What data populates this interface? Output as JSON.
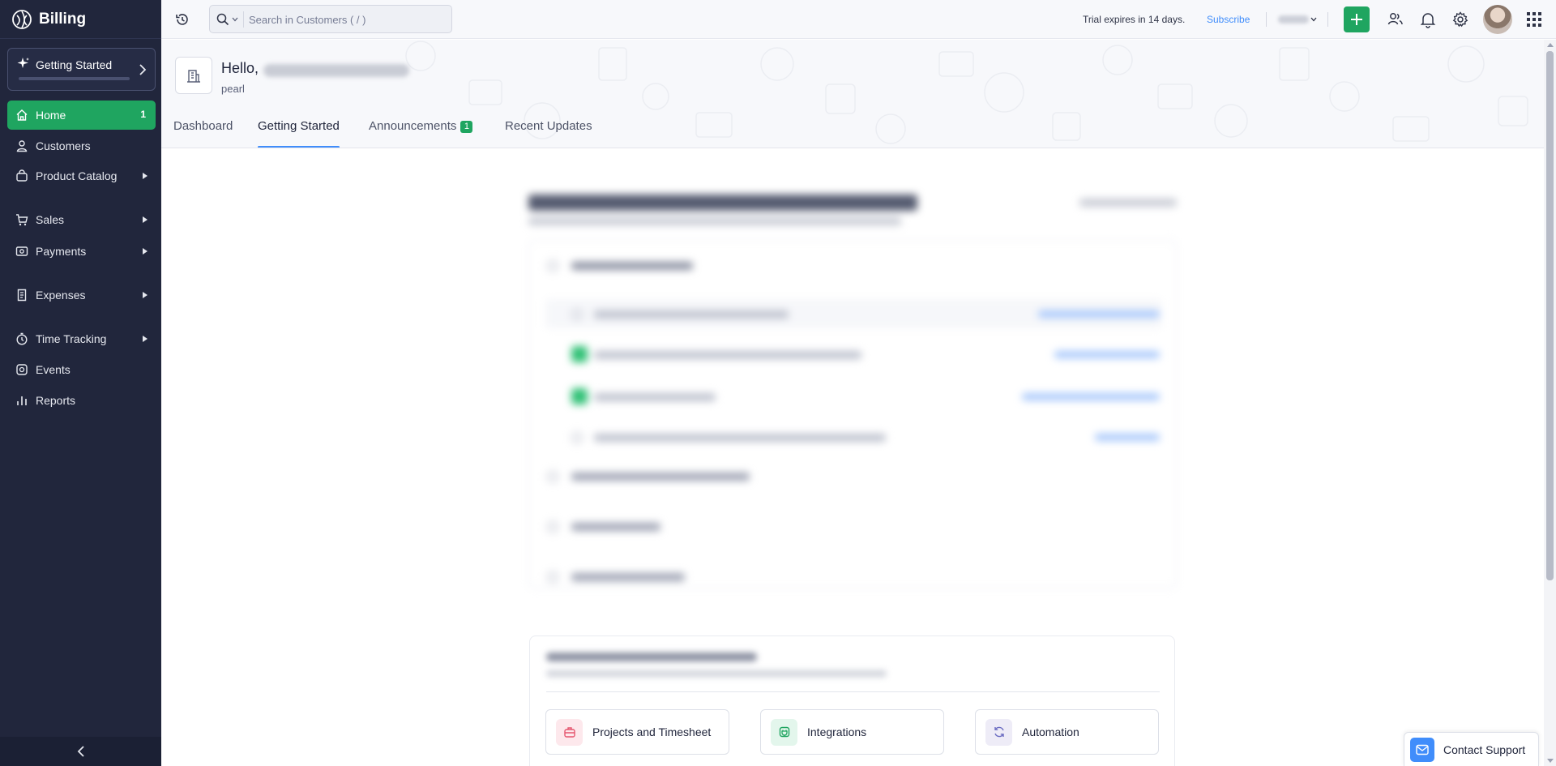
{
  "app": {
    "brand": "Billing"
  },
  "sidebar": {
    "getting_started": {
      "label": "Getting Started",
      "progress": 0
    },
    "items": [
      {
        "label": "Home",
        "badge": "1"
      },
      {
        "label": "Customers"
      },
      {
        "label": "Product Catalog"
      },
      {
        "label": "Sales"
      },
      {
        "label": "Payments"
      },
      {
        "label": "Expenses"
      },
      {
        "label": "Time Tracking"
      },
      {
        "label": "Events"
      },
      {
        "label": "Reports"
      }
    ]
  },
  "topbar": {
    "search_placeholder": "Search in Customers ( / )",
    "trial_text": "Trial expires in 14 days.",
    "subscribe_label": "Subscribe"
  },
  "header": {
    "greeting": "Hello,",
    "org_subtitle": "pearl",
    "tabs": [
      {
        "label": "Dashboard"
      },
      {
        "label": "Getting Started"
      },
      {
        "label": "Announcements",
        "badge": "1"
      },
      {
        "label": "Recent Updates"
      }
    ]
  },
  "features": [
    {
      "label": "Projects and Timesheet",
      "icon": "briefcase-icon"
    },
    {
      "label": "Integrations",
      "icon": "plug-icon"
    },
    {
      "label": "Automation",
      "icon": "refresh-icon"
    }
  ],
  "support": {
    "label": "Contact Support"
  },
  "colors": {
    "sidebar": "#21263c",
    "accent_green": "#1fa560",
    "link_blue": "#408dfb"
  }
}
